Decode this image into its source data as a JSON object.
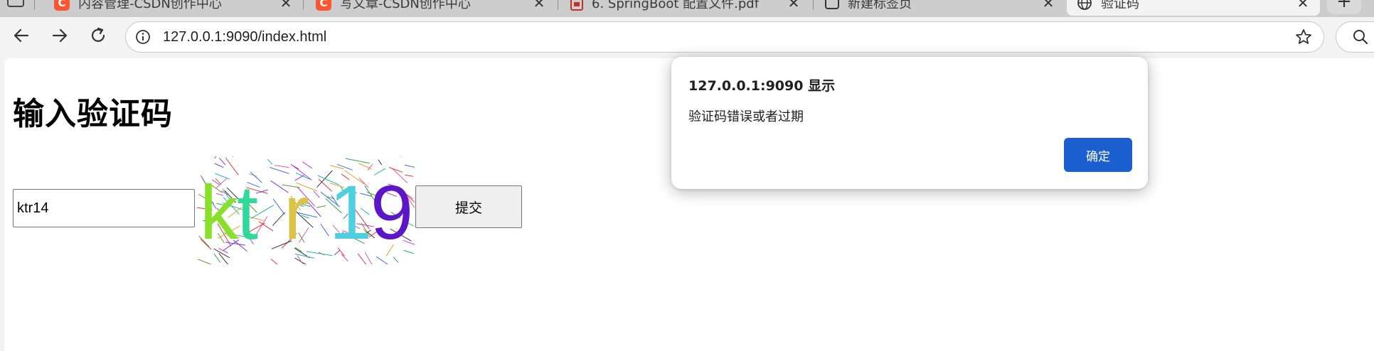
{
  "browser": {
    "tabs": [
      {
        "title": "内容管理-CSDN创作中心",
        "icon": "csdn-icon"
      },
      {
        "title": "写文章-CSDN创作中心",
        "icon": "csdn-icon"
      },
      {
        "title": "6. SpringBoot 配置文件.pdf",
        "icon": "pdf-icon"
      },
      {
        "title": "新建标签页",
        "icon": "page-icon"
      },
      {
        "title": "验证码",
        "icon": "globe-icon"
      }
    ],
    "close_glyph": "✕",
    "newtab_glyph": "+",
    "address": "127.0.0.1:9090/index.html"
  },
  "page": {
    "heading": "输入验证码",
    "input_value": "ktr14",
    "captcha_text": "ktr19",
    "captcha_chars": [
      {
        "char": "k",
        "color": "#88e02a"
      },
      {
        "char": "t",
        "color": "#2fd999"
      },
      {
        "char": "r",
        "color": "#d8c447"
      },
      {
        "char": "1",
        "color": "#4fd0e0"
      },
      {
        "char": "9",
        "color": "#5b16c8"
      }
    ],
    "submit_label": "提交"
  },
  "dialog": {
    "title": "127.0.0.1:9090 显示",
    "message": "验证码错误或者过期",
    "ok_label": "确定",
    "ok_color": "#1b5fd0"
  }
}
